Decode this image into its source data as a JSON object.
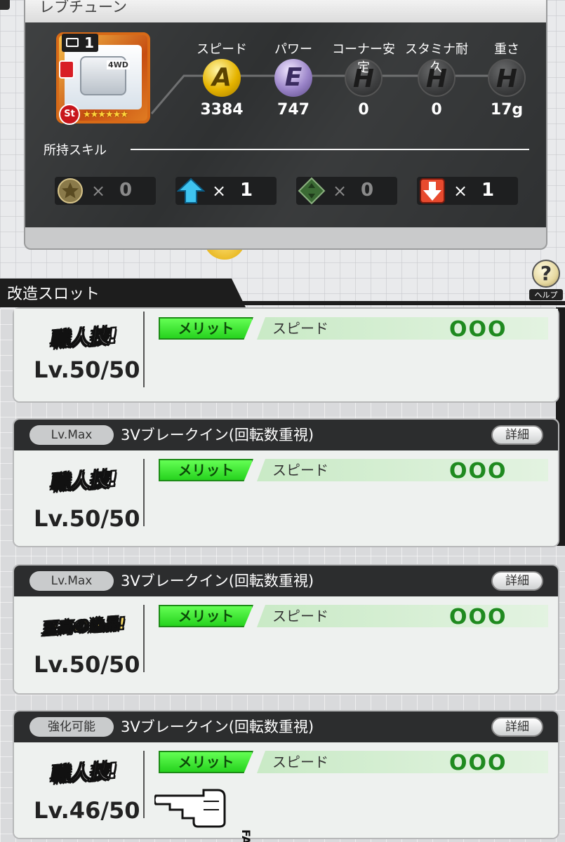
{
  "panel": {
    "title": "レブチューン"
  },
  "part": {
    "count": "1",
    "rank": "St",
    "stars": "★★★★★★",
    "motor_label": "4WD"
  },
  "stats": [
    {
      "label": "スピード",
      "grade": "A",
      "value": "3384"
    },
    {
      "label": "パワー",
      "grade": "E",
      "value": "747"
    },
    {
      "label": "コーナー安定",
      "grade": "H",
      "value": "0"
    },
    {
      "label": "スタミナ耐久",
      "grade": "H",
      "value": "0"
    },
    {
      "label": "重さ",
      "grade": "H",
      "value": "17g"
    }
  ],
  "skills": {
    "heading": "所持スキル",
    "items": [
      {
        "icon": "star-icon",
        "x": "×",
        "n": "0"
      },
      {
        "icon": "arrow-up-icon",
        "x": "×",
        "n": "1"
      },
      {
        "icon": "diamond-arrows-icon",
        "x": "×",
        "n": "0"
      },
      {
        "icon": "arrow-down-icon",
        "x": "×",
        "n": "1"
      }
    ]
  },
  "slot_header": "改造スロット",
  "help": {
    "label": "ヘルプ",
    "icon": "?"
  },
  "slots": [
    {
      "tag": "",
      "name": "",
      "detail": "",
      "badge": "職人技!",
      "level": "Lv.50/50",
      "merit": "メリット",
      "stat": "スピード",
      "rating": "OOO"
    },
    {
      "tag": "Lv.Max",
      "name": "3Vブレークイン(回転数重視)",
      "detail": "詳細",
      "badge": "職人技!",
      "level": "Lv.50/50",
      "merit": "メリット",
      "stat": "スピード",
      "rating": "OOO"
    },
    {
      "tag": "Lv.Max",
      "name": "3Vブレークイン(回転数重視)",
      "detail": "詳細",
      "badge": "至高の逸品!",
      "level": "Lv.50/50",
      "merit": "メリット",
      "stat": "スピード",
      "rating": "OOO"
    },
    {
      "tag": "強化可能",
      "name": "3Vブレークイン(回転数重視)",
      "detail": "詳細",
      "badge": "職人技!",
      "level": "Lv.46/50",
      "merit": "メリット",
      "stat": "スピード",
      "rating": "OOO"
    }
  ],
  "watermark": "FAN"
}
